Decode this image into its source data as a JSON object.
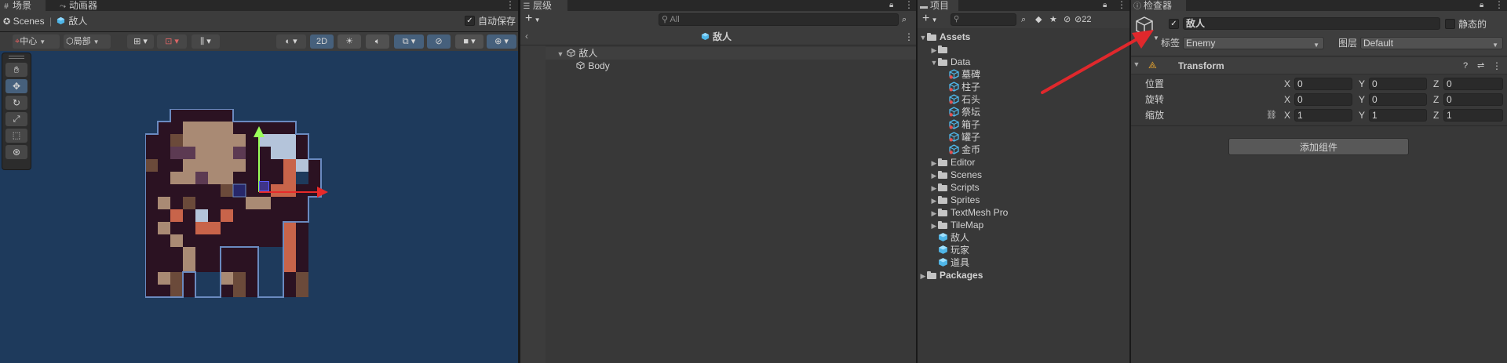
{
  "scene": {
    "tabs": [
      {
        "label": "场景"
      },
      {
        "label": "动画器"
      }
    ],
    "breadcrumb": {
      "root": "Scenes",
      "object": "敌人"
    },
    "autosave_label": "自动保存",
    "autosave_checked": true,
    "toolbar": {
      "pivot_label": "中心",
      "space_label": "局部",
      "mode_2d": "2D"
    },
    "tools": [
      {
        "name": "hand-tool-icon"
      },
      {
        "name": "move-tool-icon"
      },
      {
        "name": "rotate-tool-icon"
      },
      {
        "name": "scale-tool-icon"
      },
      {
        "name": "rect-tool-icon"
      },
      {
        "name": "transform-tool-icon"
      }
    ],
    "background_color": "#1e3a5c",
    "selection_outline_color": "#6a8ac0"
  },
  "hierarchy": {
    "tab_label": "层级",
    "search_placeholder": "All",
    "header_title": "敌人",
    "items": [
      {
        "label": "敌人",
        "depth": 0,
        "expanded": true
      },
      {
        "label": "Body",
        "depth": 1
      }
    ]
  },
  "project": {
    "tab_label": "项目",
    "hidden_count": "22",
    "tree": [
      {
        "label": "Assets",
        "type": "folder",
        "depth": 0,
        "expanded": true,
        "bold": true
      },
      {
        "label": "",
        "type": "folder",
        "depth": 1,
        "expanded": false
      },
      {
        "label": "Data",
        "type": "folder",
        "depth": 1,
        "expanded": true
      },
      {
        "label": "墓碑",
        "type": "asset",
        "depth": 2
      },
      {
        "label": "柱子",
        "type": "asset",
        "depth": 2
      },
      {
        "label": "石头",
        "type": "asset",
        "depth": 2
      },
      {
        "label": "祭坛",
        "type": "asset",
        "depth": 2
      },
      {
        "label": "箱子",
        "type": "asset",
        "depth": 2
      },
      {
        "label": "罐子",
        "type": "asset",
        "depth": 2
      },
      {
        "label": "金币",
        "type": "asset",
        "depth": 2
      },
      {
        "label": "Editor",
        "type": "folder",
        "depth": 1,
        "expanded": false
      },
      {
        "label": "Scenes",
        "type": "folder",
        "depth": 1,
        "expanded": false
      },
      {
        "label": "Scripts",
        "type": "folder",
        "depth": 1,
        "expanded": false
      },
      {
        "label": "Sprites",
        "type": "folder",
        "depth": 1,
        "expanded": false
      },
      {
        "label": "TextMesh Pro",
        "type": "folder",
        "depth": 1,
        "expanded": false
      },
      {
        "label": "TileMap",
        "type": "folder",
        "depth": 1,
        "expanded": false
      },
      {
        "label": "敌人",
        "type": "prefab",
        "depth": 1
      },
      {
        "label": "玩家",
        "type": "prefab",
        "depth": 1
      },
      {
        "label": "道具",
        "type": "prefab",
        "depth": 1
      },
      {
        "label": "Packages",
        "type": "folder",
        "depth": 0,
        "expanded": false,
        "bold": true
      }
    ]
  },
  "inspector": {
    "tab_label": "检查器",
    "object_name": "敌人",
    "active_checked": true,
    "static_label": "静态的",
    "tag_label": "标签",
    "tag_value": "Enemy",
    "layer_label": "图层",
    "layer_value": "Default",
    "component_title": "Transform",
    "position_label": "位置",
    "rotation_label": "旋转",
    "scale_label": "缩放",
    "axis_x": "X",
    "axis_y": "Y",
    "axis_z": "Z",
    "position": {
      "x": "0",
      "y": "0",
      "z": "0"
    },
    "rotation": {
      "x": "0",
      "y": "0",
      "z": "0"
    },
    "scale": {
      "x": "1",
      "y": "1",
      "z": "1"
    },
    "add_component_label": "添加组件"
  },
  "annotation_arrow_color": "#e0282c"
}
